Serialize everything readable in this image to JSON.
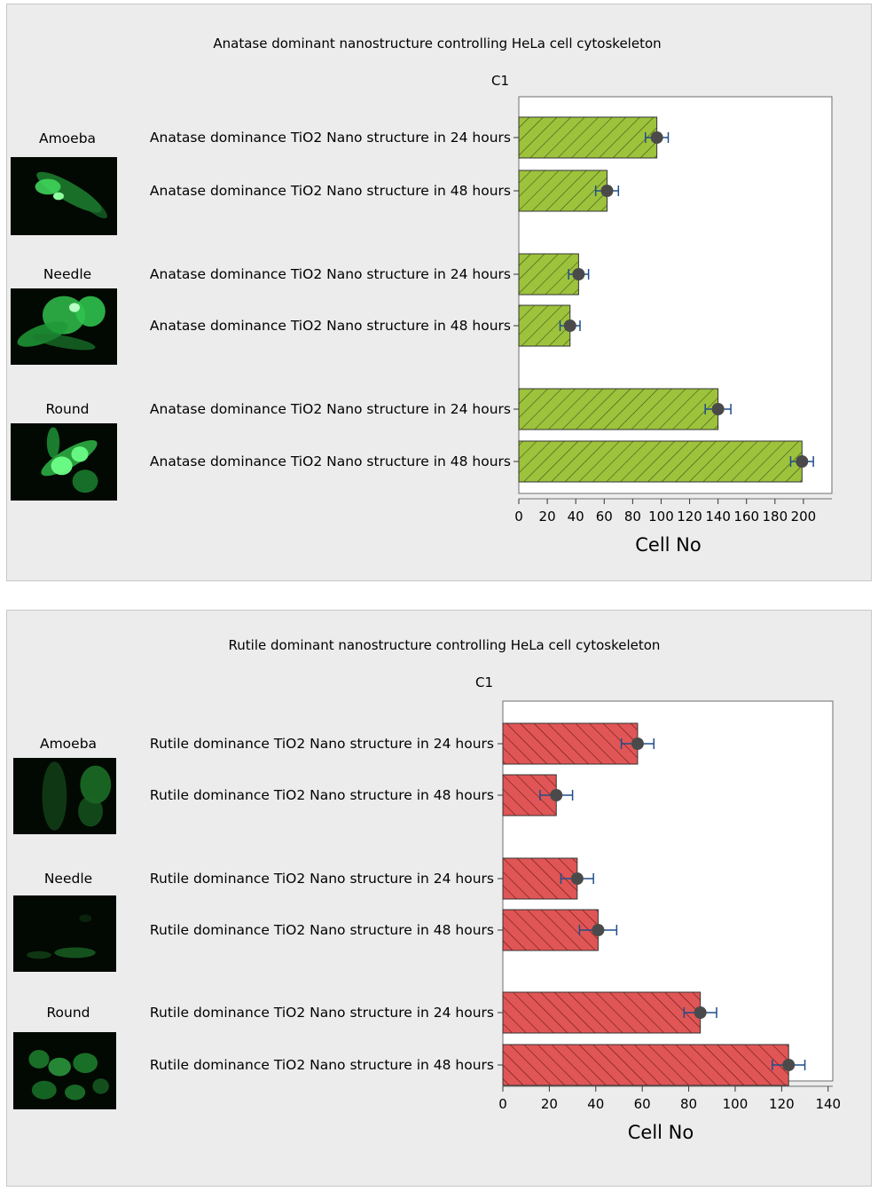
{
  "chart_data": [
    {
      "type": "bar",
      "orientation": "horizontal",
      "title": "Anatase dominant nanostructure controlling HeLa cell cytoskeleton",
      "panel_label": "C1",
      "xlabel": "Cell No",
      "xlim": [
        0,
        220
      ],
      "xticks": [
        0,
        20,
        40,
        60,
        80,
        100,
        120,
        140,
        160,
        180,
        200
      ],
      "xtick_labels": [
        "0",
        "20",
        "40",
        "60",
        "80",
        "100",
        "120",
        "140",
        "160",
        "180",
        "200"
      ],
      "bar_color": "#9dc23c",
      "hatch": "forward-diagonal",
      "groups": [
        "Amoeba",
        "Needle",
        "Round"
      ],
      "categories": [
        "Anatase dominance TiO2 Nano structure in 24 hours",
        "Anatase dominance TiO2 Nano structure in 48 hours",
        "Anatase dominance TiO2 Nano structure in 24 hours",
        "Anatase dominance TiO2 Nano structure in 48 hours",
        "Anatase dominance TiO2 Nano structure in 24 hours",
        "Anatase dominance TiO2 Nano structure in 48 hours"
      ],
      "values": [
        97,
        62,
        42,
        36,
        140,
        199
      ],
      "errors": [
        8,
        8,
        7,
        7,
        9,
        8
      ]
    },
    {
      "type": "bar",
      "orientation": "horizontal",
      "title": "Rutile dominant nanostructure controlling HeLa cell cytoskeleton",
      "panel_label": "C1",
      "xlabel": "Cell No",
      "xlim": [
        0,
        142
      ],
      "xticks": [
        0,
        20,
        40,
        60,
        80,
        100,
        120,
        140
      ],
      "xtick_labels": [
        "0",
        "20",
        "40",
        "60",
        "80",
        "100",
        "120",
        "140"
      ],
      "bar_color": "#e05555",
      "hatch": "back-diagonal",
      "groups": [
        "Amoeba",
        "Needle",
        "Round"
      ],
      "categories": [
        "Rutile dominance TiO2 Nano structure in 24 hours",
        "Rutile dominance TiO2 Nano structure in 48 hours",
        "Rutile dominance TiO2 Nano structure in 24 hours",
        "Rutile dominance TiO2 Nano structure in 48 hours",
        "Rutile dominance TiO2 Nano structure in 24 hours",
        "Rutile dominance TiO2 Nano structure in 48 hours"
      ],
      "values": [
        58,
        23,
        32,
        41,
        85,
        123
      ],
      "errors": [
        7,
        7,
        7,
        8,
        7,
        7
      ]
    }
  ]
}
